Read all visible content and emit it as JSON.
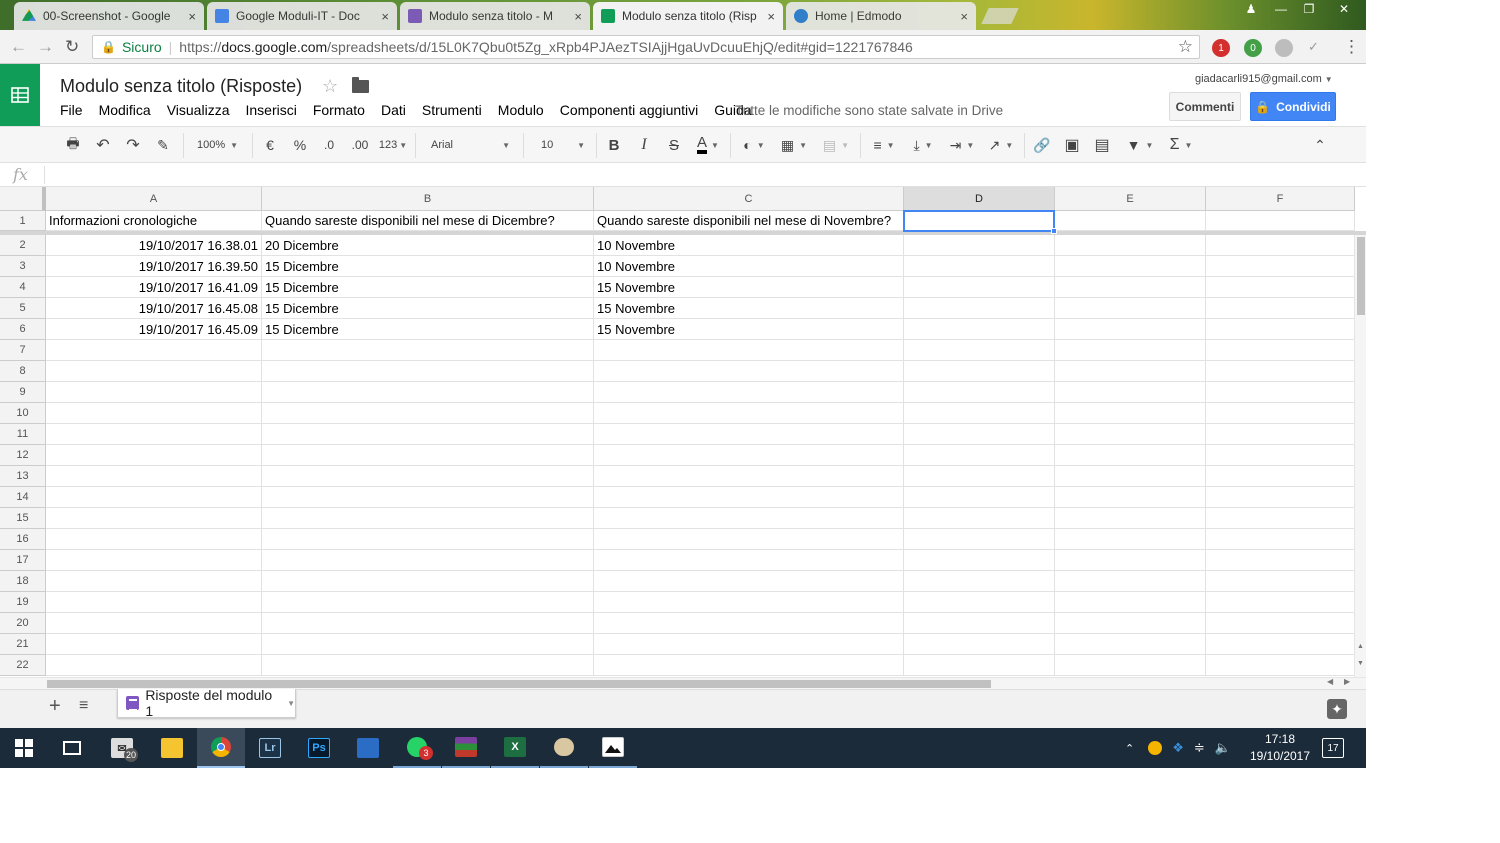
{
  "browser": {
    "tabs": [
      {
        "label": "00-Screenshot - Google",
        "icon": "google-drive-icon",
        "color": "#f4b400"
      },
      {
        "label": "Google Moduli-IT - Doc",
        "icon": "google-docs-icon",
        "color": "#4285f4"
      },
      {
        "label": "Modulo senza titolo - M",
        "icon": "google-forms-icon",
        "color": "#7e57c2"
      },
      {
        "label": "Modulo senza titolo (Risp",
        "icon": "google-sheets-icon",
        "color": "#0f9d58"
      },
      {
        "label": "Home | Edmodo",
        "icon": "edmodo-icon",
        "color": "#2a7bd6"
      }
    ],
    "close_glyph": "×",
    "secure_label": "Sicuro",
    "url_prefix": "https://",
    "url_domain": "docs.google.com",
    "url_path": "/spreadsheets/d/15L0K7Qbu0t5Zg_xRpb4PJAezTSIAjjHgaUvDcuuEhjQ/edit#gid=1221767846",
    "extensions": [
      {
        "icon": "opera-extension-icon",
        "badge": "1",
        "color": "#d32f2f"
      },
      {
        "icon": "green-extension-icon",
        "badge": "0",
        "color": "#43a047"
      },
      {
        "icon": "drive-extension-icon",
        "badge": "",
        "color": "#bdbdbd"
      }
    ]
  },
  "docs": {
    "title": "Modulo senza titolo (Risposte)",
    "menu": [
      "File",
      "Modifica",
      "Visualizza",
      "Inserisci",
      "Formato",
      "Dati",
      "Strumenti",
      "Modulo",
      "Componenti aggiuntivi",
      "Guida"
    ],
    "saved_status": "Tutte le modifiche sono state salvate in Drive",
    "account_email": "giadacarli915@gmail.com",
    "comments_label": "Commenti",
    "share_label": "Condividi",
    "brand_color": "#0f9d58",
    "share_color": "#4285f4"
  },
  "toolbar": {
    "zoom": "100%",
    "currency": "€",
    "percent": "%",
    "decrease_decimals": ".0",
    "increase_decimals": ".00",
    "number_format": "123",
    "font": "Arial",
    "font_size": "10",
    "bold": "B",
    "italic": "I",
    "strikethrough": "S",
    "text_color": "A",
    "functions": "Σ"
  },
  "formula_bar": {
    "label": "fx",
    "value": ""
  },
  "sheet": {
    "columns": [
      "A",
      "B",
      "C",
      "D",
      "E",
      "F"
    ],
    "selected_column": "D",
    "selected_cell": "D1",
    "row_numbers": [
      "1",
      "2",
      "3",
      "4",
      "5",
      "6",
      "7",
      "8",
      "9",
      "10",
      "11",
      "12",
      "13",
      "14",
      "15",
      "16",
      "17",
      "18",
      "19",
      "20",
      "21",
      "22"
    ],
    "header_row": [
      "Informazioni cronologiche",
      "Quando sareste disponibili nel mese di Dicembre?",
      "Quando sareste disponibili nel mese di Novembre?"
    ],
    "rows": [
      [
        "19/10/2017 16.38.01",
        "20 Dicembre",
        "10 Novembre"
      ],
      [
        "19/10/2017 16.39.50",
        "15 Dicembre",
        "10 Novembre"
      ],
      [
        "19/10/2017 16.41.09",
        "15 Dicembre",
        "15 Novembre"
      ],
      [
        "19/10/2017 16.45.08",
        "15 Dicembre",
        "15 Novembre"
      ],
      [
        "19/10/2017 16.45.09",
        "15 Dicembre",
        "15 Novembre"
      ]
    ],
    "tab_name": "Risposte del modulo 1"
  },
  "taskbar": {
    "apps": [
      {
        "name": "task-view",
        "label": ""
      },
      {
        "name": "mail",
        "badge": "20"
      },
      {
        "name": "file-explorer",
        "label": ""
      },
      {
        "name": "chrome",
        "label": ""
      },
      {
        "name": "lightroom",
        "label": "Lr"
      },
      {
        "name": "photoshop",
        "label": "Ps"
      },
      {
        "name": "blue-app",
        "label": ""
      },
      {
        "name": "whatsapp",
        "badge": "3"
      },
      {
        "name": "winrar",
        "label": ""
      },
      {
        "name": "excel",
        "label": "X"
      },
      {
        "name": "paint",
        "label": ""
      },
      {
        "name": "photos",
        "label": ""
      }
    ],
    "time": "17:18",
    "date": "19/10/2017",
    "notifications": "17"
  }
}
